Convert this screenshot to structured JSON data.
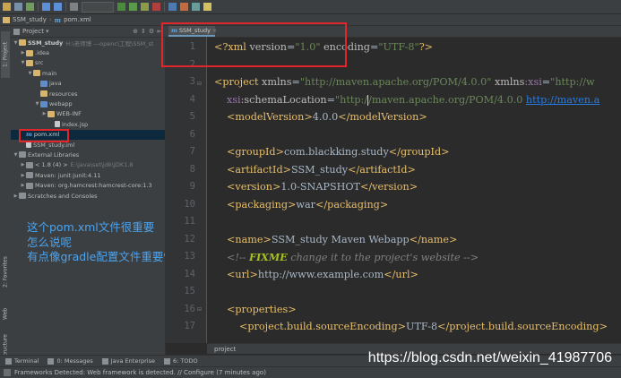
{
  "breadcrumb": {
    "project": "SSM_study",
    "file": "pom.xml"
  },
  "left_strip": {
    "project_tab": "1: Project",
    "favorites_tab": "2: Favorites",
    "web_tab": "Web",
    "structure_tab": "Z: Structure"
  },
  "project_panel": {
    "title": "Project",
    "tree": [
      {
        "label": "SSM_study",
        "muted": "H:\\老师博 ---openc\\工程\\SSM_st",
        "arrow": "▼"
      },
      {
        "label": ".idea",
        "arrow": "▶"
      },
      {
        "label": "src",
        "arrow": "▼"
      },
      {
        "label": "main",
        "arrow": "▼"
      },
      {
        "label": "java",
        "arrow": ""
      },
      {
        "label": "resources",
        "arrow": ""
      },
      {
        "label": "webapp",
        "arrow": "▼"
      },
      {
        "label": "WEB-INF",
        "arrow": "▶"
      },
      {
        "label": "index.jsp",
        "arrow": ""
      },
      {
        "label": "pom.xml",
        "arrow": ""
      },
      {
        "label": "SSM_study.iml",
        "arrow": ""
      },
      {
        "label": "External Libraries",
        "arrow": "▼"
      },
      {
        "label": "< 1.8 (4) >",
        "muted": "E:\\java\\set\\jdk\\JDK1.8",
        "arrow": "▶"
      },
      {
        "label": "Maven: junit:junit:4.11",
        "arrow": "▶"
      },
      {
        "label": "Maven: org.hamcrest:hamcrest-core:1.3",
        "arrow": "▶"
      },
      {
        "label": "Scratches and Consoles",
        "arrow": "▶"
      }
    ]
  },
  "annotation": {
    "line1": "这个pom.xml文件很重要",
    "line2": "怎么说呢",
    "line3": "有点像gradle配置文件重要性"
  },
  "editor": {
    "tab_label": "SSM_study",
    "line_numbers": [
      "1",
      "2",
      "3",
      "4",
      "5",
      "6",
      "7",
      "8",
      "9",
      "10",
      "11",
      "12",
      "13",
      "14",
      "15",
      "16",
      "17"
    ],
    "xml_decl": {
      "version_attr": "version",
      "version": "\"1.0\"",
      "encoding_attr": "encoding",
      "encoding": "\"UTF-8\""
    },
    "project_open": {
      "tag": "<project",
      "xmlns_attr": "xmlns",
      "xmlns_val": "\"http://maven.apache.org/POM/4.0.0\"",
      "xsi_attr_ns": "xmlns",
      "xsi_attr": ":xsi",
      "xsi_val": "\"http://w"
    },
    "schema": {
      "attr_ns": "xsi",
      "attr": ":schemaLocation",
      "val_start": "\"http:/",
      "val_rest": "/maven.apache.org/POM/4.0.0 ",
      "url": "http://maven.a"
    },
    "lines": {
      "modelVersion": {
        "tag": "modelVersion",
        "value": "4.0.0"
      },
      "groupId": {
        "tag": "groupId",
        "value": "com.blackking.study"
      },
      "artifactId": {
        "tag": "artifactId",
        "value": "SSM_study"
      },
      "version": {
        "tag": "version",
        "value": "1.0-SNAPSHOT"
      },
      "packaging": {
        "tag": "packaging",
        "value": "war"
      },
      "name": {
        "tag": "name",
        "value": "SSM_study Maven Webapp"
      },
      "comment": {
        "open": "<!-- ",
        "todo": "FIXME",
        "text": " change it to the project's website ",
        "close": "-->"
      },
      "url": {
        "tag": "url",
        "value": "http://www.example.com"
      },
      "properties": {
        "tag": "properties"
      },
      "encoding": {
        "tag": "project.build.sourceEncoding",
        "value": "UTF-8"
      }
    },
    "crumb": "project"
  },
  "bottom_tabs": [
    "Terminal",
    "0: Messages",
    "Java Enterprise",
    "6: TODO"
  ],
  "status": {
    "text": "Frameworks Detected: Web framework is detected. // Configure (7 minutes ago)"
  },
  "watermark": "https://blog.csdn.net/weixin_41987706",
  "colors": {
    "annotation": "#4aa3f0",
    "highlight_box": "#e0262b",
    "xml_tag": "#e8bf6a",
    "xml_value": "#6a8759"
  }
}
